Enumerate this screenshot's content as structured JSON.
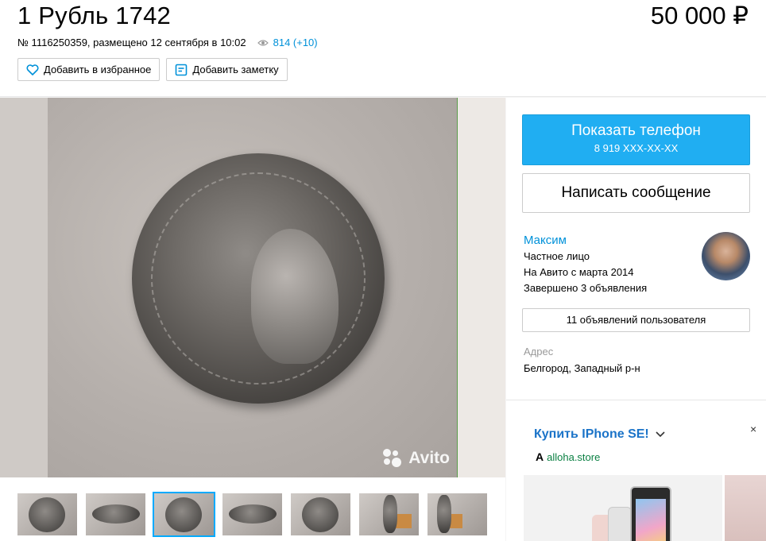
{
  "listing": {
    "title": "1 Рубль 1742",
    "price": "50 000 ₽",
    "meta_text": "№ 1116250359, размещено 12 сентября в 10:02",
    "views": "814 (+10)",
    "favorite_label": "Добавить в избранное",
    "note_label": "Добавить заметку"
  },
  "gallery": {
    "watermark": "Avito",
    "thumbnails": [
      "thumb-1",
      "thumb-2",
      "thumb-3",
      "thumb-4",
      "thumb-5",
      "thumb-6",
      "thumb-7"
    ],
    "active_thumbnail": 3
  },
  "contact": {
    "show_phone_label": "Показать телефон",
    "phone_masked": "8 919 XXX-XX-XX",
    "message_label": "Написать сообщение"
  },
  "seller": {
    "name": "Максим",
    "type": "Частное лицо",
    "since": "На Авито с марта 2014",
    "completed": "Завершено 3 объявления",
    "ads_button": "11 объявлений пользователя",
    "address_label": "Адрес",
    "address_value": "Белгород, Западный р-н"
  },
  "ad": {
    "title": "Купить IPhone SE!",
    "source": "alloha.store",
    "close": "×"
  },
  "colors": {
    "accent": "#20aef2",
    "link": "#0091d9"
  }
}
